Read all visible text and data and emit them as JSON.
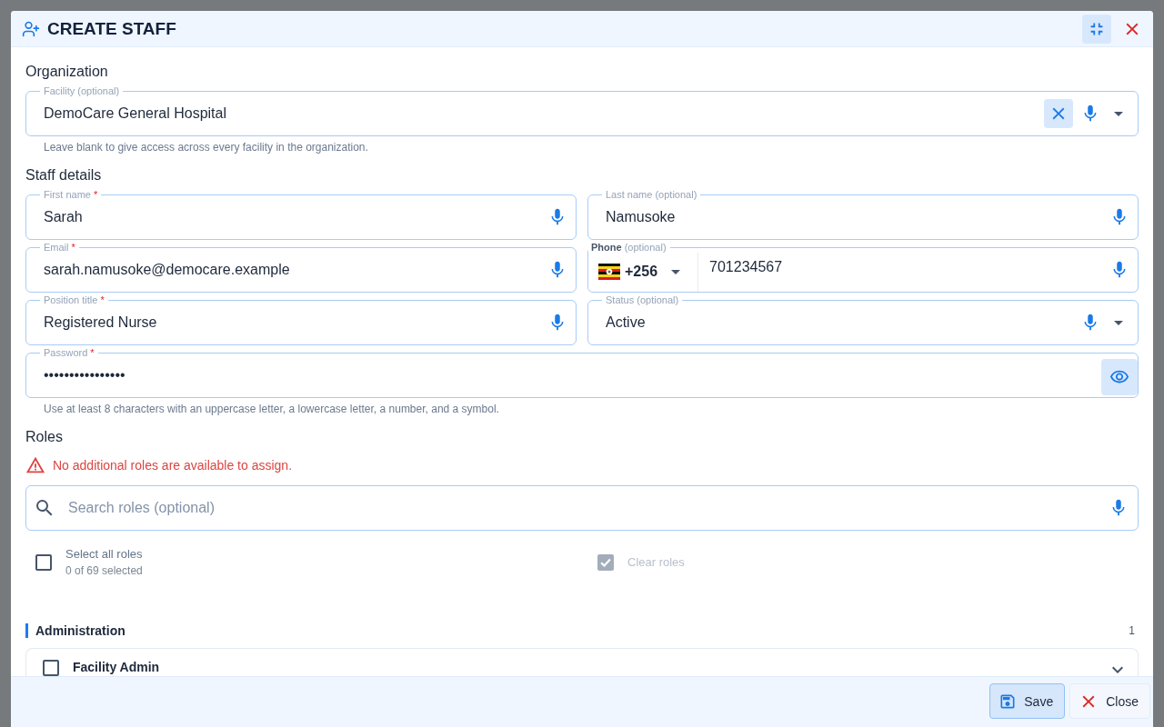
{
  "dialog": {
    "title": "CREATE STAFF"
  },
  "organization": {
    "heading": "Organization",
    "facility": {
      "kind": "select",
      "label": "Facility",
      "marker": "(optional)",
      "required": false,
      "value": "DemoCare General Hospital",
      "clearable": true
    },
    "helper": "Leave blank to give access across every facility in the organization."
  },
  "staff_details": {
    "heading": "Staff details",
    "fields": [
      {
        "kind": "text",
        "label": "First name",
        "marker": "*",
        "required": true,
        "value": "Sarah"
      },
      {
        "kind": "text",
        "label": "Last name",
        "marker": "(optional)",
        "required": false,
        "value": "Namusoke"
      },
      {
        "kind": "text",
        "label": "Email",
        "marker": "*",
        "required": true,
        "value": "sarah.namusoke@democare.example"
      },
      {
        "kind": "phone",
        "label": "Phone",
        "marker": "(optional)",
        "required": false,
        "country_code": "+256",
        "value": "701234567"
      },
      {
        "kind": "text",
        "label": "Position title",
        "marker": "*",
        "required": true,
        "value": "Registered Nurse"
      },
      {
        "kind": "select",
        "label": "Status",
        "marker": "(optional)",
        "required": false,
        "value": "Active"
      }
    ],
    "password": {
      "kind": "password",
      "label": "Password",
      "marker": "*",
      "required": true,
      "value": "••••••••••••••••",
      "helper": "Use at least 8 characters with an uppercase letter, a lowercase letter, a number, and a symbol."
    }
  },
  "roles": {
    "heading": "Roles",
    "warning": "No additional roles are available to assign.",
    "search": {
      "placeholder": "Search roles (optional)"
    },
    "select_all": {
      "label": "Select all roles",
      "count": "0 of 69 selected",
      "checked": false
    },
    "clear": {
      "label": "Clear roles",
      "checked": true,
      "disabled": true
    },
    "groups": [
      {
        "name": "Administration",
        "count": "1",
        "items": [
          {
            "name": "Facility Admin",
            "checked": false,
            "expanded": false
          }
        ]
      }
    ]
  },
  "footer": {
    "buttons": [
      {
        "kind": "save",
        "label": "Save",
        "primary": true
      },
      {
        "kind": "close",
        "label": "Close",
        "primary": false
      }
    ]
  }
}
